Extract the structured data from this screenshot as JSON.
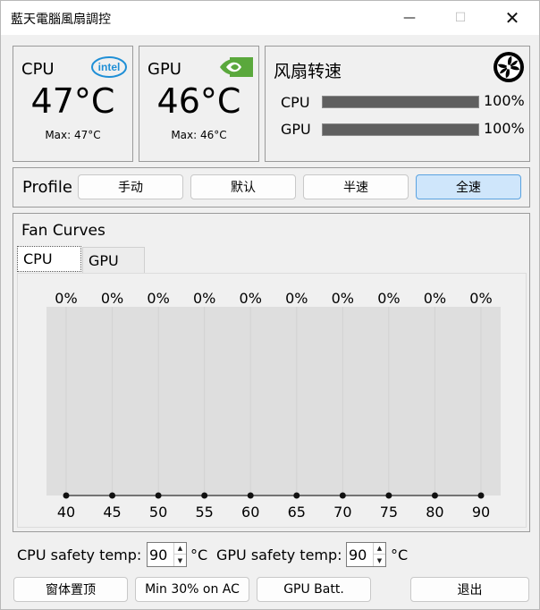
{
  "window": {
    "title": "藍天電腦風扇調控",
    "minimize_glyph": "—",
    "maximize_glyph": "☐",
    "close_glyph": "✕"
  },
  "cpu_card": {
    "label": "CPU",
    "temp": "47°C",
    "max": "Max: 47°C",
    "logo_text": "intel",
    "logo_color": "#1f8fd6"
  },
  "gpu_card": {
    "label": "GPU",
    "temp": "46°C",
    "max": "Max: 46°C",
    "logo": "nvidia-icon",
    "logo_color": "#5aa83c"
  },
  "fan_speed": {
    "title": "风扇转速",
    "icon": "fan-icon",
    "rows": [
      {
        "label": "CPU",
        "percent": "100%",
        "level": 1.0
      },
      {
        "label": "GPU",
        "percent": "100%",
        "level": 1.0
      }
    ]
  },
  "profile": {
    "label": "Profile",
    "buttons": [
      "手动",
      "默认",
      "半速",
      "全速"
    ],
    "active_index": 3,
    "accent": "#cfe6fb"
  },
  "fan_curves": {
    "title": "Fan Curves",
    "tabs": [
      "CPU",
      "GPU"
    ],
    "selected_tab": 0
  },
  "chart_data": {
    "type": "line",
    "x": [
      40,
      45,
      50,
      55,
      60,
      65,
      70,
      75,
      80,
      90
    ],
    "y": [
      0,
      0,
      0,
      0,
      0,
      0,
      0,
      0,
      0,
      0
    ],
    "point_labels": [
      "0%",
      "0%",
      "0%",
      "0%",
      "0%",
      "0%",
      "0%",
      "0%",
      "0%",
      "0%"
    ],
    "ylim": [
      0,
      100
    ],
    "grid": true
  },
  "settings": {
    "cpu_safety_label": "CPU safety temp:",
    "cpu_safety_value": "90",
    "gpu_safety_label": "GPU safety temp:",
    "gpu_safety_value": "90",
    "unit": "°C"
  },
  "bottom_buttons": {
    "pin": "窗体置顶",
    "min30": "Min 30% on AC",
    "gpu_batt": "GPU Batt.",
    "exit": "退出"
  }
}
